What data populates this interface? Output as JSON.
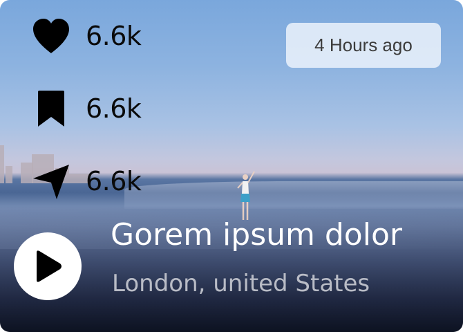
{
  "stats": {
    "likes": {
      "count": "6.6k",
      "icon": "heart-icon"
    },
    "saves": {
      "count": "6.6k",
      "icon": "bookmark-icon"
    },
    "shares": {
      "count": "6.6k",
      "icon": "send-icon"
    }
  },
  "timestamp": "4 Hours ago",
  "post": {
    "title": "Gorem ipsum dolor",
    "location": "London, united States"
  },
  "player": {
    "icon": "play-icon"
  }
}
